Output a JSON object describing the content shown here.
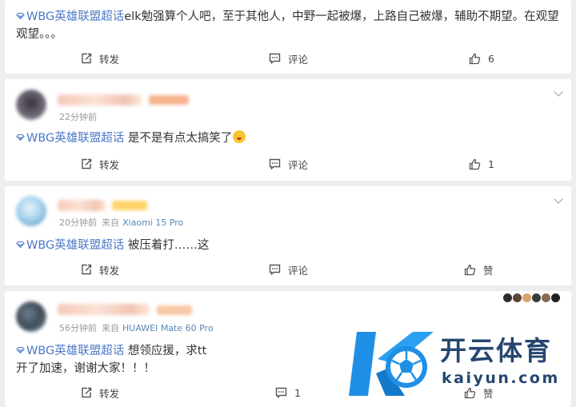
{
  "topic_label": "WBG英雄联盟超话",
  "posts": [
    {
      "text": "elk勉强算个人吧，至于其他人，中野一起被爆，上路自己被爆，辅助不期望。在观望观望。。。",
      "actions": {
        "repost": "转发",
        "comment": "评论",
        "like": "6"
      }
    },
    {
      "time": "22分钟前",
      "text": "是不是有点太搞笑了",
      "actions": {
        "repost": "转发",
        "comment": "评论",
        "like": "1"
      }
    },
    {
      "time": "20分钟前",
      "source_prefix": "来自",
      "device": "Xiaomi 15 Pro",
      "text": "被压着打……这",
      "actions": {
        "repost": "转发",
        "comment": "评论",
        "like": "赞"
      }
    },
    {
      "time": "56分钟前",
      "source_prefix": "来自",
      "device": "HUAWEI Mate 60 Pro",
      "text_line1": "想领应援，求tt",
      "text_line2": "开了加速，谢谢大家！！！",
      "actions": {
        "repost": "转发",
        "comment": "1",
        "like": "赞"
      }
    }
  ],
  "watermark": {
    "title": "开云体育",
    "url": "kaiyun.com"
  },
  "colors": {
    "topic_blue": "#4b78c6",
    "background": "#eeeef0",
    "watermark_blue": "#1f8fe5",
    "watermark_text": "#25466f"
  },
  "icons": [
    "chevron-down-icon",
    "diamond-topic-icon",
    "repost-icon",
    "comment-icon",
    "thumbs-up-icon",
    "emoji-icon"
  ]
}
